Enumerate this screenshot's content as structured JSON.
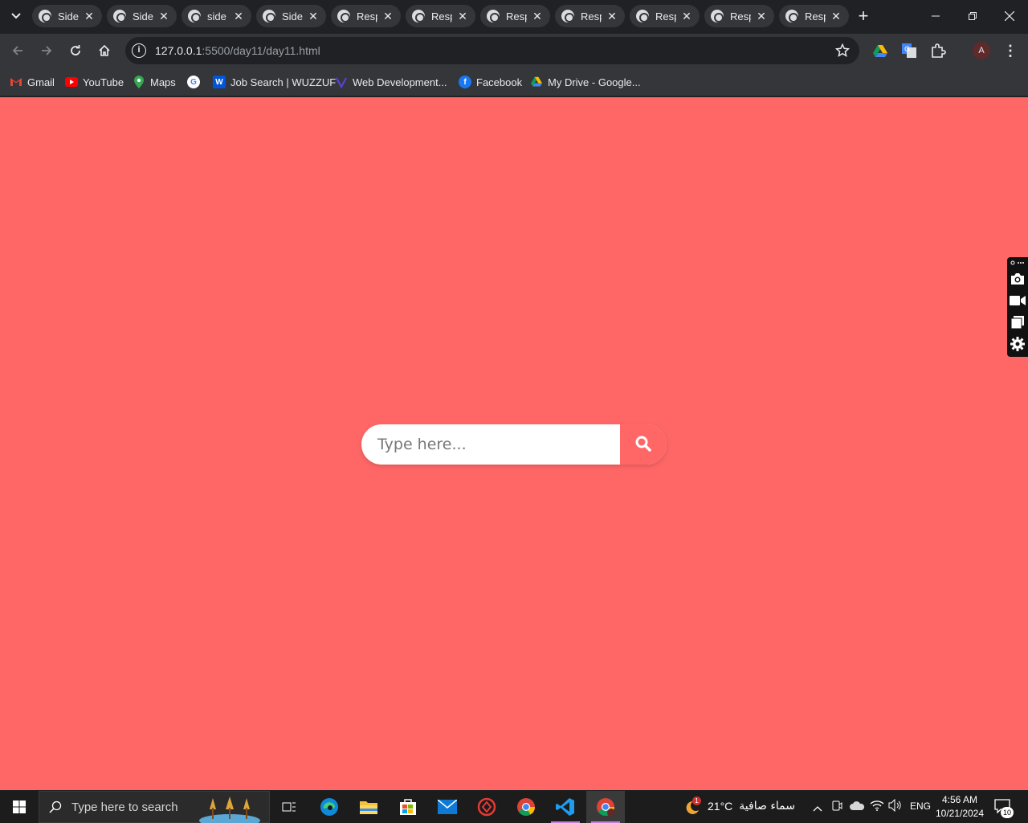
{
  "browser": {
    "tabs": [
      {
        "title": "Side"
      },
      {
        "title": "Side"
      },
      {
        "title": "side"
      },
      {
        "title": "Side"
      },
      {
        "title": "Resp"
      },
      {
        "title": "Resp"
      },
      {
        "title": "Resp"
      },
      {
        "title": "Resp"
      },
      {
        "title": "Resp"
      },
      {
        "title": "Resp"
      },
      {
        "title": "Resp"
      }
    ],
    "url_host": "127.0.0.1",
    "url_rest": ":5500/day11/day11.html",
    "profile_initial": "A",
    "bookmarks": [
      {
        "label": "Gmail",
        "icon": "gmail-icon"
      },
      {
        "label": "YouTube",
        "icon": "youtube-icon"
      },
      {
        "label": "Maps",
        "icon": "maps-icon"
      },
      {
        "label": "",
        "icon": "google-icon"
      },
      {
        "label": "Job Search | WUZZUF",
        "icon": "wuzzuf-icon"
      },
      {
        "label": "Web Development...",
        "icon": "web-dev-icon"
      },
      {
        "label": "Facebook",
        "icon": "facebook-icon"
      },
      {
        "label": "My Drive - Google...",
        "icon": "drive-icon"
      }
    ]
  },
  "page": {
    "background": "#ff6767",
    "search": {
      "placeholder": "Type here...",
      "button_icon": "search-icon"
    }
  },
  "taskbar": {
    "search_placeholder": "Type here to search",
    "weather_temp": "21°C",
    "weather_desc": "سماء صافية",
    "weather_badge": "1",
    "language": "ENG",
    "time": "4:56 AM",
    "date": "10/21/2024",
    "notification_count": "10"
  }
}
